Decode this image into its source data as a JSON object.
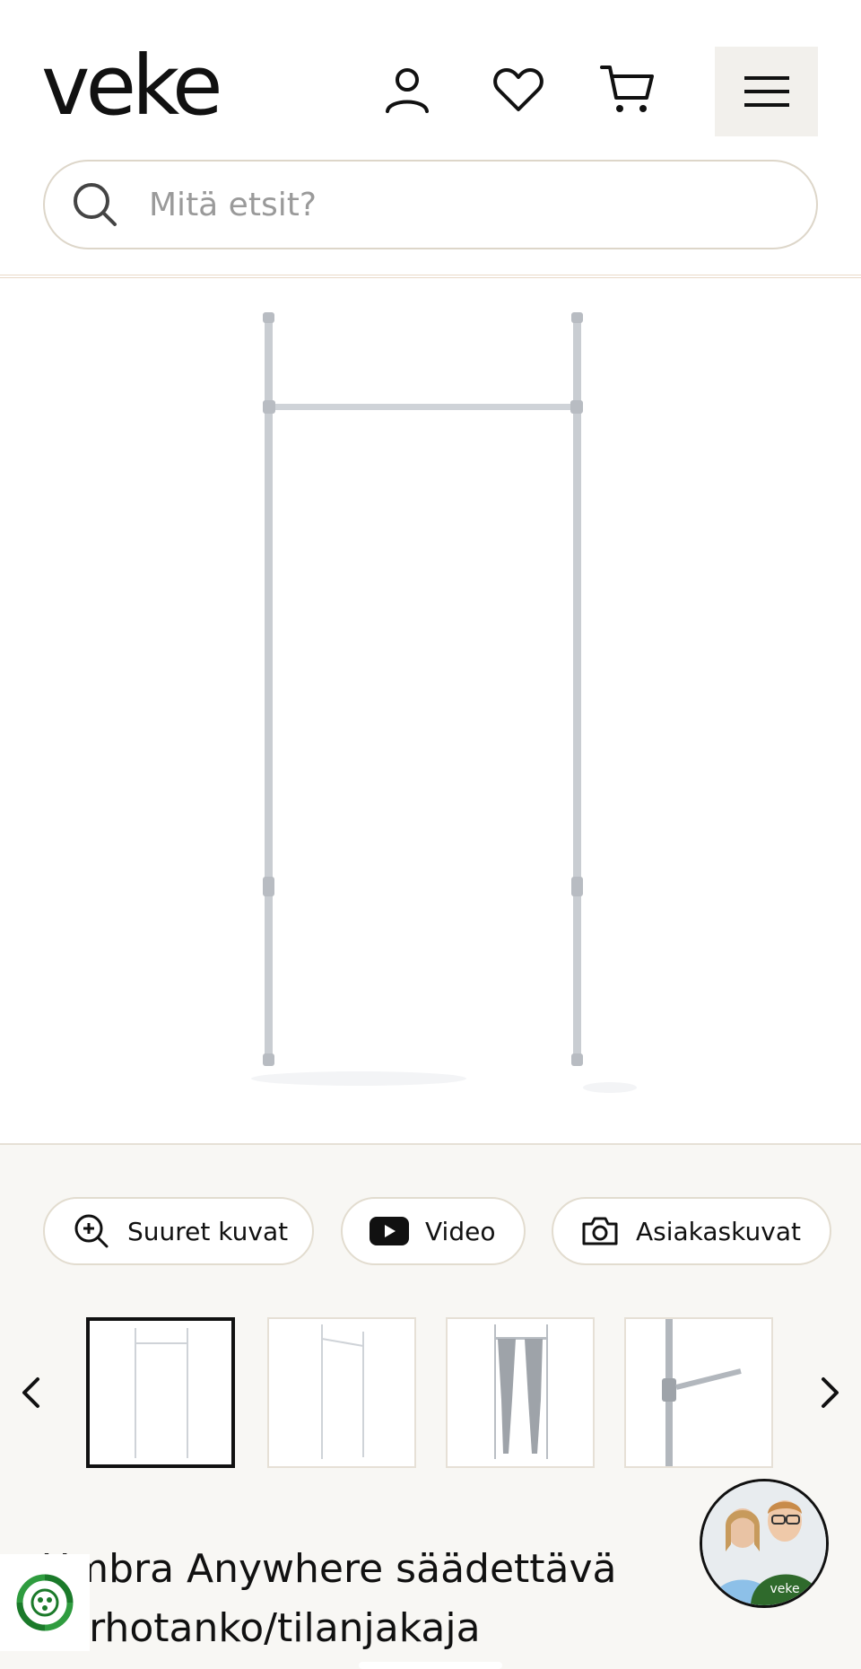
{
  "header": {
    "logo_text": "veke",
    "account_icon": "user-icon",
    "wishlist_icon": "heart-icon",
    "cart_icon": "cart-icon",
    "menu_icon": "hamburger-menu-icon"
  },
  "search": {
    "placeholder": "Mitä etsit?",
    "value": "",
    "icon": "search-icon"
  },
  "product": {
    "image_icon": "curtain-rod-frame-image",
    "title_line1": "Umbra Anywhere säädettävä",
    "title_line2": "verhotanko/tilanjakaja"
  },
  "media_buttons": [
    {
      "label": "Suuret kuvat",
      "icon": "zoom-in-icon"
    },
    {
      "label": "Video",
      "icon": "youtube-play-icon"
    },
    {
      "label": "Asiakaskuvat",
      "icon": "camera-icon"
    }
  ],
  "gallery": {
    "prev_icon": "chevron-left-icon",
    "next_icon": "chevron-right-icon",
    "thumbnails": [
      "front-view",
      "angled-view",
      "with-curtains",
      "detail-closeup"
    ],
    "active_index": 0
  },
  "chat": {
    "avatar_text": "veke"
  },
  "colors": {
    "accent": "#1b7a2a",
    "pill_border": "#e2dccf",
    "lower_bg": "#f8f7f4"
  }
}
